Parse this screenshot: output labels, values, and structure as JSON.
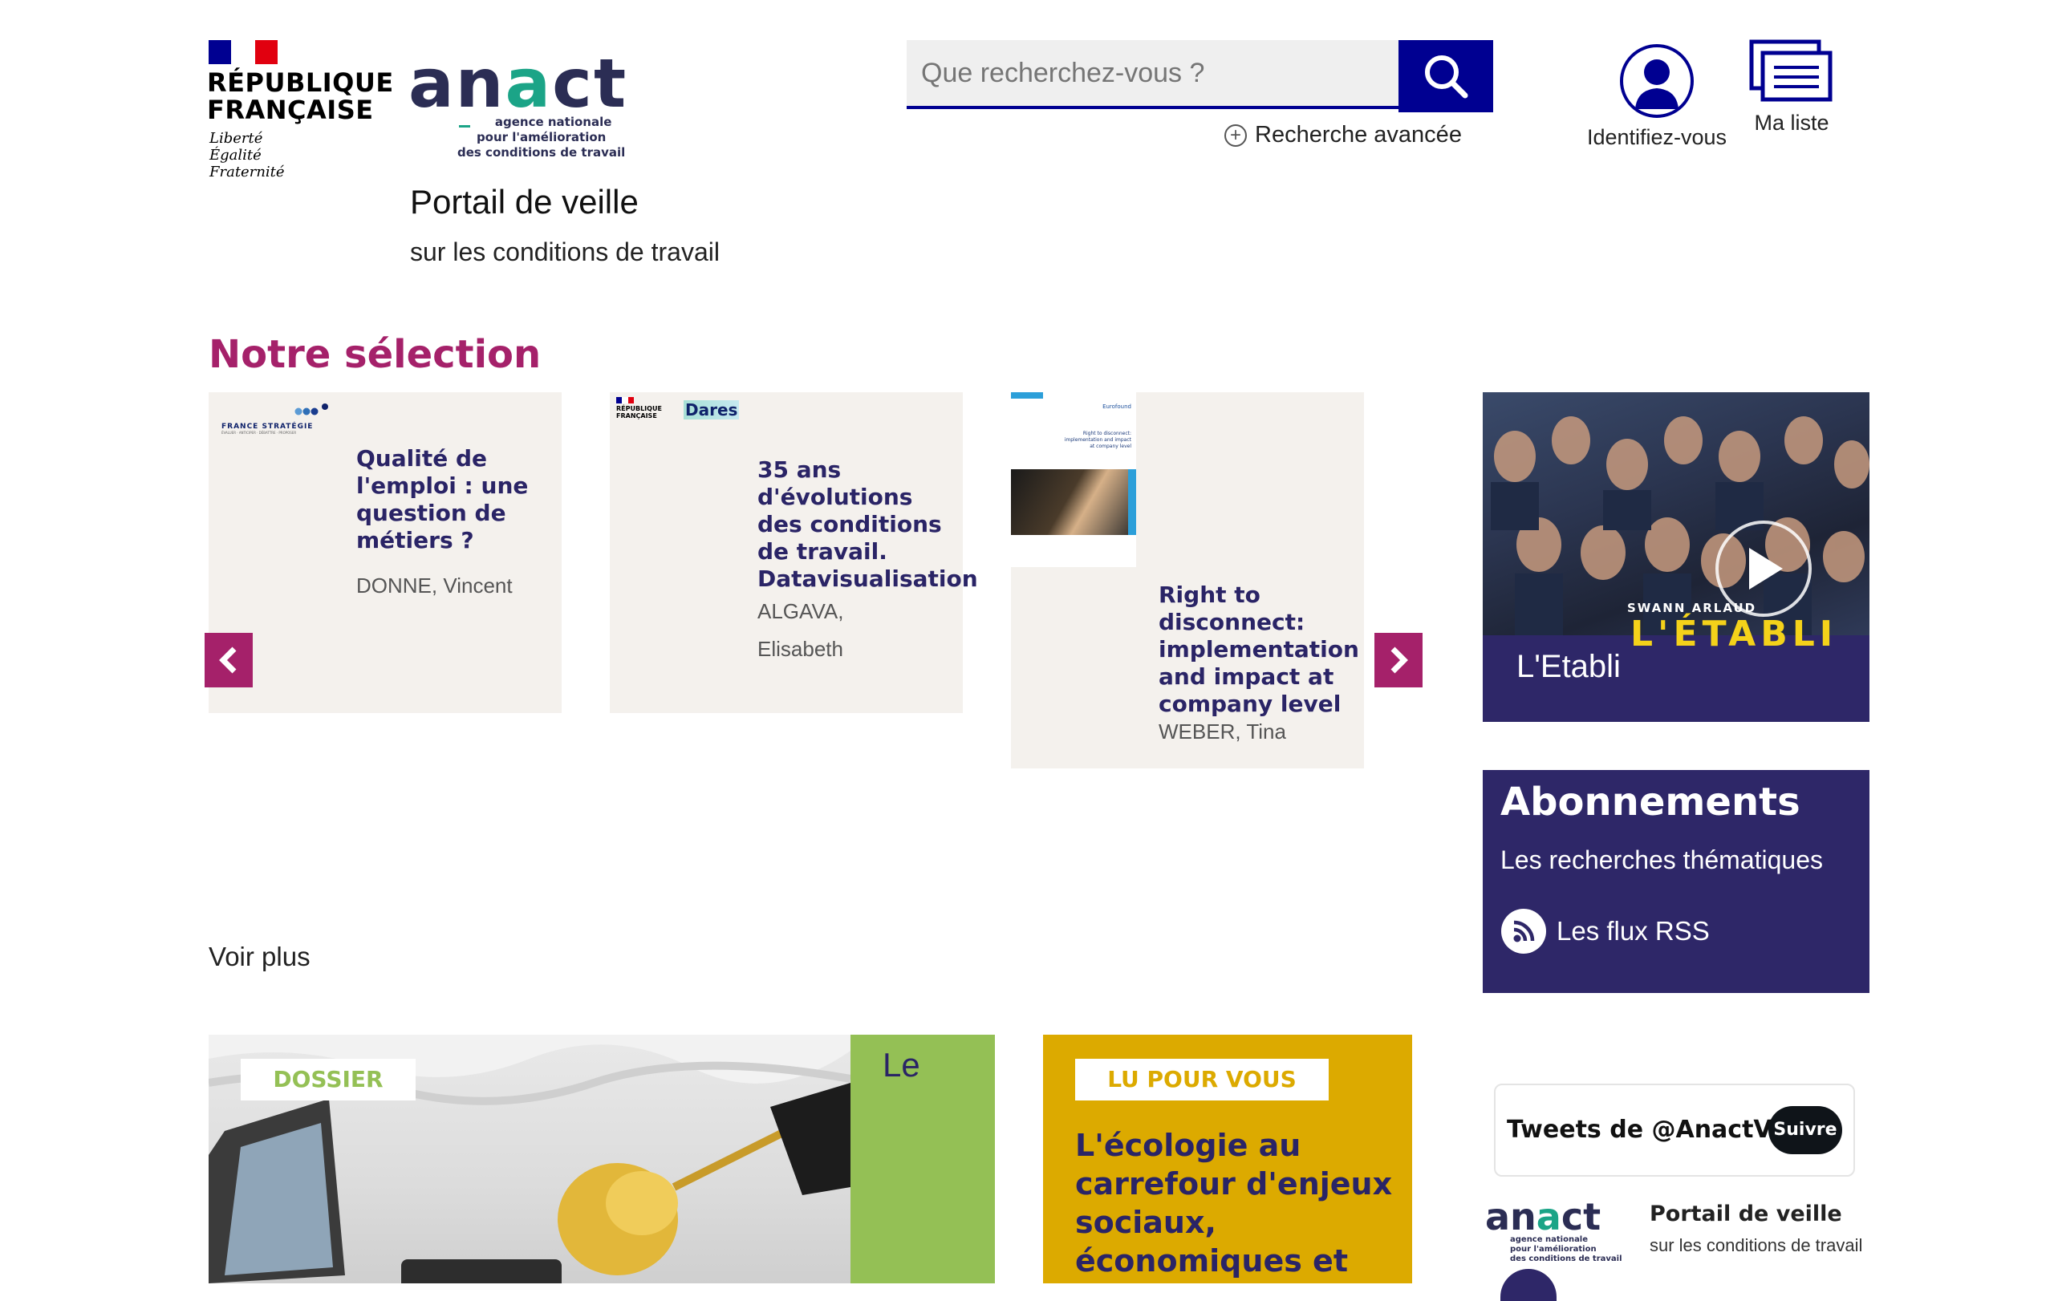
{
  "header": {
    "rf_title_line1": "RÉPUBLIQUE",
    "rf_title_line2": "FRANÇAISE",
    "rf_motto_line1": "Liberté",
    "rf_motto_line2": "Égalité",
    "rf_motto_line3": "Fraternité",
    "anact_logo_part1": "an",
    "anact_logo_c": "a",
    "anact_logo_part2": "ct",
    "anact_sub_line1": "agence nationale",
    "anact_sub_line2": "pour l'amélioration",
    "anact_sub_line3": "des conditions de travail",
    "portal_title": "Portail de veille",
    "portal_subtitle": "sur les conditions de travail",
    "search_placeholder": "Que recherchez-vous ?",
    "advanced_search": "Recherche avancée",
    "login_label": "Identifiez-vous",
    "mylist_label": "Ma liste"
  },
  "selection": {
    "title": "Notre sélection",
    "cards": [
      {
        "title": "Qualité de l'emploi : une question de métiers ?",
        "title_lines": [
          "Qualité de",
          "l'emploi : une",
          "question de",
          "métiers ?"
        ],
        "author": "DONNE, Vincent",
        "publisher": "FRANCE STRATÉGIE",
        "publisher_tag": "ÉVALUER · ANTICIPER · DÉBATTRE · PROPOSER"
      },
      {
        "title_lines": [
          "35 ans",
          "d'évolutions",
          "des conditions",
          "de travail.",
          "Datavisualisation"
        ],
        "author_lines": [
          "ALGAVA,",
          "Elisabeth"
        ],
        "publisher": "Dares",
        "publisher_rf": "RÉPUBLIQUE FRANÇAISE"
      },
      {
        "title_lines": [
          "Right to",
          "disconnect:",
          "implementation",
          "and impact at",
          "company level"
        ],
        "author": "WEBER, Tina",
        "publisher": "Eurofound",
        "cover_lines": [
          "Right to disconnect:",
          "implementation and impact",
          "at company level"
        ]
      }
    ],
    "voir_plus": "Voir plus"
  },
  "video": {
    "title": "L'Etabli",
    "overlay_name": "SWANN ARLAUD",
    "overlay_title": "L'ÉTABLI"
  },
  "subscriptions": {
    "title": "Abonnements",
    "thematic_link": "Les recherches thématiques",
    "rss_link": "Les flux RSS"
  },
  "bottom": {
    "dossier_tag": "DOSSIER",
    "dossier_text": "Le",
    "lu_tag": "LU POUR VOUS",
    "lu_title": "L'écologie au carrefour d'enjeux sociaux, économiques et",
    "tweets_label": "Tweets de @AnactVeille",
    "follow_label": "Suivre",
    "tw_portal_title": "Portail de veille",
    "tw_portal_sub": "sur les conditions de travail"
  },
  "colors": {
    "brand_navy": "#000091",
    "anact_purple": "#2e2768",
    "accent_magenta": "#a5216a",
    "card_bg": "#f4f1ed",
    "green": "#94c055",
    "gold": "#dcaa00"
  }
}
